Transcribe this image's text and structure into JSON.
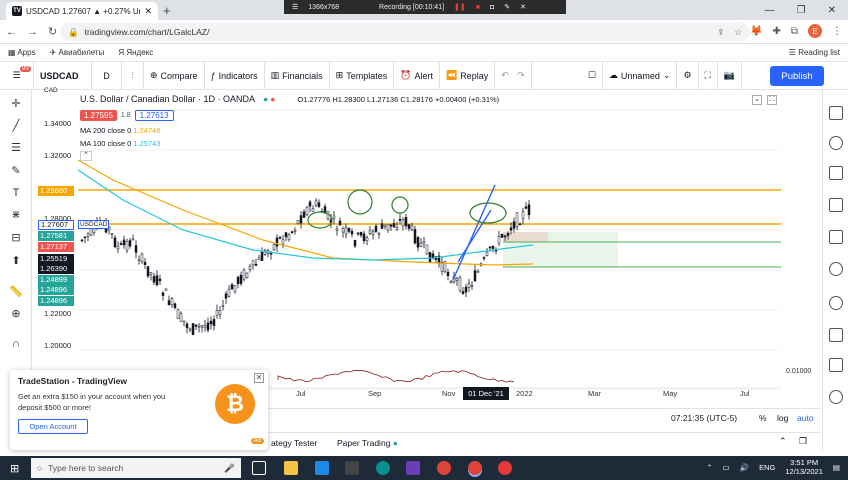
{
  "browser": {
    "tab_title": "USDCAD 1.27607 ▲ +0.27% Un",
    "new_tab": "+",
    "recording": {
      "resolution": "1366x768",
      "status": "Recording [00:10:41]"
    },
    "url": "tradingview.com/chart/LGalcLAZ/",
    "bookmarks": [
      "Apps",
      "Авиабилеты",
      "Яндекс"
    ],
    "reading_list": "Reading list",
    "profile_initial": "E",
    "ext_badge": "99"
  },
  "toolbar": {
    "symbol": "USDCAD",
    "interval": "D",
    "compare": "Compare",
    "indicators": "Indicators",
    "financials": "Financials",
    "templates": "Templates",
    "alert": "Alert",
    "replay": "Replay",
    "layout_name": "Unnamed",
    "publish": "Publish"
  },
  "legend": {
    "title": "U.S. Dollar / Canadian Dollar · 1D · OANDA",
    "ohlc": "O1.27776 H1.28300 L1.27136 C1.28176 +0.00400 (+0.31%)",
    "sell_price": "1.27595",
    "spread": "1.8",
    "buy_price": "1.27613",
    "ma200": {
      "label": "MA 200 close 0",
      "value": "1.24746"
    },
    "ma100": {
      "label": "MA 100 close 0",
      "value": "1.25743"
    }
  },
  "price_scale": {
    "currency": "CAD",
    "ticks": [
      "1.34000",
      "1.32000",
      "1.28000",
      "1.22000",
      "1.20000"
    ],
    "labels": [
      {
        "text": "1.29660",
        "color": "#f7a600"
      },
      {
        "text": "1.27607",
        "color": "#ffffff"
      },
      {
        "text": "1.27581",
        "color": "#26a69a"
      },
      {
        "text": "1.27137",
        "color": "#ef5350"
      },
      {
        "text": "1.25519",
        "color": "#131722"
      },
      {
        "text": "1.26390",
        "color": "#131722"
      },
      {
        "text": "1.24899",
        "color": "#26a69a"
      },
      {
        "text": "1.24896",
        "color": "#26a69a"
      },
      {
        "text": "1.24896",
        "color": "#26a69a"
      }
    ],
    "symbol_tag": "USDCAD",
    "osc_value": "0.01000"
  },
  "time_axis": {
    "labels": [
      "Jul",
      "Sep",
      "Nov",
      "2022",
      "Mar",
      "May",
      "Jul"
    ],
    "selected": "01 Dec '21"
  },
  "status_bar": {
    "time": "07:21:35 (UTC-5)",
    "percent": "%",
    "log": "log",
    "auto": "auto"
  },
  "bottom_tabs": [
    "ategy Tester",
    "Paper Trading"
  ],
  "ad": {
    "title": "TradeStation - TradingView",
    "text": "Get an extra $150 in your account when you deposit $500 or more!",
    "button": "Open Account",
    "badge": "Ad",
    "coin": "₿"
  },
  "taskbar": {
    "search_placeholder": "Type here to search",
    "lang": "ENG",
    "time": "3:51 PM",
    "date": "12/13/2021"
  },
  "colors": {
    "accent": "#2962ff",
    "up": "#26a69a",
    "down": "#ef5350",
    "ma200": "#f7a600",
    "ma100": "#26c6da"
  }
}
